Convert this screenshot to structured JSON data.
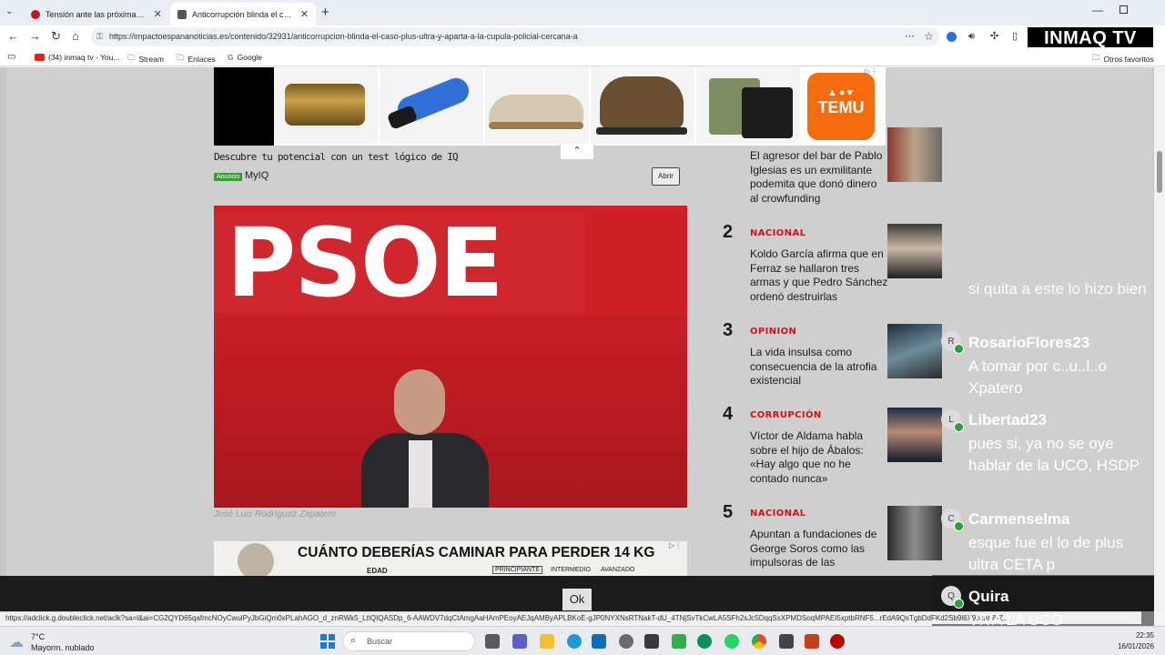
{
  "tabs": [
    {
      "title": "Tensión ante las próximas eleccion",
      "active": false
    },
    {
      "title": "Anticorrupción blinda el caso Plus",
      "active": true
    }
  ],
  "address": {
    "url": "https://impactoespananoticias.es/contenido/32931/anticorrupcion-blinda-el-caso-plus-ultra-y-aparta-a-la-cupula-policial-cercana-a"
  },
  "bookmarks": {
    "items": [
      "(34) inmaq tv - You...",
      "Stream",
      "Enlaces",
      "Google"
    ],
    "others": "Otros favoritos"
  },
  "overlay_logo": "INMAQ TV",
  "ad_top": {
    "brand": "TEMU",
    "caption": "Descubre tu potencial con un test lógico de IQ",
    "badge": "Anuncio",
    "advertiser": "MyIQ",
    "open_button": "Abrir"
  },
  "article": {
    "image_sign_text": "PSOE",
    "photo_credit": "José Luis Rodríguez Zapatero"
  },
  "ad_bottom": {
    "headline": "CUÁNTO DEBERÍAS CAMINAR PARA PERDER 14 KG",
    "col_edad": "EDAD",
    "levels": [
      "PRINCIPIANTE",
      "INTERMEDIO",
      "AVANZADO"
    ]
  },
  "sidebar": {
    "items": [
      {
        "num": "",
        "category": "",
        "title": "El agresor del bar de Pablo Iglesias es un exmilitante podemita que donó dinero al crowfunding"
      },
      {
        "num": "2",
        "category": "NACIONAL",
        "title": "Koldo García afirma que en Ferraz se hallaron tres armas y que Pedro Sánchez ordenó destruirlas"
      },
      {
        "num": "3",
        "category": "OPINION",
        "title": "La vida insulsa como consecuencia de la atrofia existencial"
      },
      {
        "num": "4",
        "category": "CORRUPCIÓN",
        "title": "Víctor de Aldama habla sobre el hijo de Ábalos: «Hay algo que no he contado nunca»"
      },
      {
        "num": "5",
        "category": "NACIONAL",
        "title": "Apuntan a fundaciones de George Soros como las impulsoras de las"
      }
    ]
  },
  "chat": [
    {
      "user": "",
      "initial": "",
      "message": "si quita a este lo hizo bien"
    },
    {
      "user": "RosarioFlores23",
      "initial": "R",
      "message": "A tomar por c..u..l..o Xpatero"
    },
    {
      "user": "Libertad23",
      "initial": "L",
      "message": "pues si, ya no se oye hablar de la UCO, HSDP"
    },
    {
      "user": "Carmenselma",
      "initial": "C",
      "message": "esque fue el lo de plus ultra CETA p"
    },
    {
      "user": "Quira",
      "initial": "Q",
      "message": "VIVA LA UCO"
    }
  ],
  "cookie": {
    "ok_label": "Ok"
  },
  "status_url": "https://adclick.g.doubleclick.net/aclk?sa=l&ai=CG2QYD65qafmcNOyCwulPyJbGiQm0xPLahAGO_d_znRWk5_LtIQIQASDp_6-AAWDV7dqCtAmgAaHAmPEoyAEJqAMByAPLBKoE-gJP0NYXNsRTNakT-dU_4TNjSvTkCwLA5SFh2sJc5DqqSsXPMDSoqMPAEI5xptbRNF5...rEdA9QsTgbDdFKd2Sb9l6X9hcat-8-Z...",
  "taskbar": {
    "weather_temp": "7°C",
    "weather_desc": "Mayorm. nublado",
    "search_placeholder": "Buscar",
    "time": "22:35",
    "date": "16/01/2026"
  }
}
